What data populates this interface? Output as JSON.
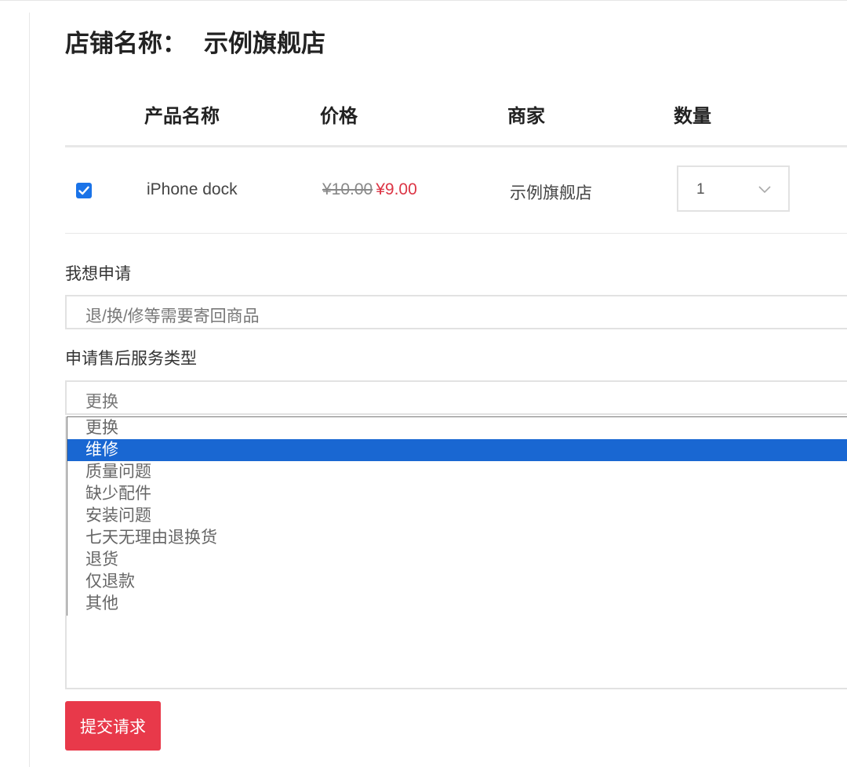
{
  "store": {
    "label": "店铺名称：",
    "name": "示例旗舰店"
  },
  "table": {
    "headers": [
      "产品名称",
      "价格",
      "商家",
      "数量"
    ],
    "row": {
      "checked": true,
      "product_name": "iPhone dock",
      "price_original": "¥10.00",
      "price_current": "¥9.00",
      "merchant": "示例旗舰店",
      "quantity": "1"
    }
  },
  "form": {
    "request_label": "我想申请",
    "request_value": "退/换/修等需要寄回商品",
    "service_type_label": "申请售后服务类型",
    "service_type_value": "更换",
    "service_type_options": [
      "更换",
      "维修",
      "质量问题",
      "缺少配件",
      "安装问题",
      "七天无理由退换货",
      "退货",
      "仅退款",
      "其他"
    ],
    "highlighted_option": "维修",
    "submit_label": "提交请求"
  },
  "colors": {
    "accent_blue": "#1967d2",
    "price_red": "#dc3545",
    "submit_red": "#e8394a"
  }
}
